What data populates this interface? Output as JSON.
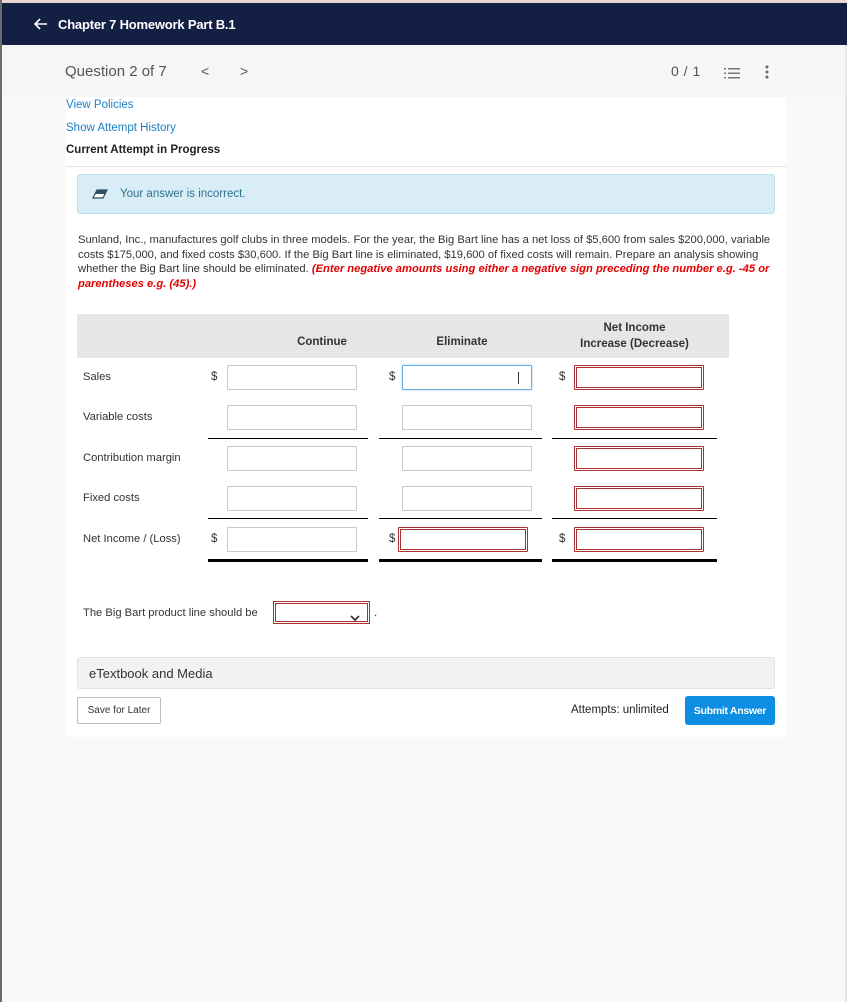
{
  "topbar": {
    "back_icon": "arrow-left-icon",
    "title": "Chapter 7 Homework Part B.1"
  },
  "question_header": {
    "question_label": "Question 2 of 7",
    "prev": "<",
    "next": ">",
    "score": "0 / 1",
    "list_icon": "numbered-list-icon",
    "more_icon": "vertical-ellipsis-icon"
  },
  "links": {
    "view_policies": "View Policies",
    "show_attempt_history": "Show Attempt History",
    "current_attempt": "Current Attempt in Progress"
  },
  "alert": {
    "icon": "eraser-icon",
    "message": "Your answer is incorrect.",
    "color": "#d9edf7"
  },
  "question": {
    "text": "Sunland, Inc., manufactures golf clubs in three models. For the year, the Big Bart line has a net loss of $5,600 from sales $200,000, variable costs $175,000, and fixed costs $30,600. If the Big Bart line is eliminated, $19,600 of fixed costs will remain. Prepare an analysis showing whether the Big Bart line should be eliminated.",
    "hint": "(Enter negative amounts using either a negative sign preceding the number e.g. -45 or parentheses e.g. (45).)"
  },
  "table": {
    "headers": [
      "Continue",
      "Eliminate",
      "Net Income Increase (Decrease)"
    ],
    "header_net_line1": "Net Income",
    "header_net_line2": "Increase (Decrease)",
    "currency": "$",
    "rows": [
      {
        "label": "Sales",
        "continue": "",
        "eliminate": "",
        "net": ""
      },
      {
        "label": "Variable costs",
        "continue": "",
        "eliminate": "",
        "net": ""
      },
      {
        "label": "Contribution margin",
        "continue": "",
        "eliminate": "",
        "net": ""
      },
      {
        "label": "Fixed costs",
        "continue": "",
        "eliminate": "",
        "net": ""
      },
      {
        "label": "Net Income / (Loss)",
        "continue": "",
        "eliminate": "",
        "net": ""
      }
    ]
  },
  "conclusion": {
    "text": "The Big Bart product line should be",
    "selected": "",
    "period": "."
  },
  "etextbook": "eTextbook and Media",
  "footer": {
    "save_label": "Save for Later",
    "attempts": "Attempts: unlimited",
    "submit_label": "Submit Answer",
    "submit_color": "#0d8ee2"
  },
  "colors": {
    "topbar": "#141f44",
    "link": "#1a7fc4",
    "error_border": "#a63232",
    "hint_red": "#e60000"
  }
}
